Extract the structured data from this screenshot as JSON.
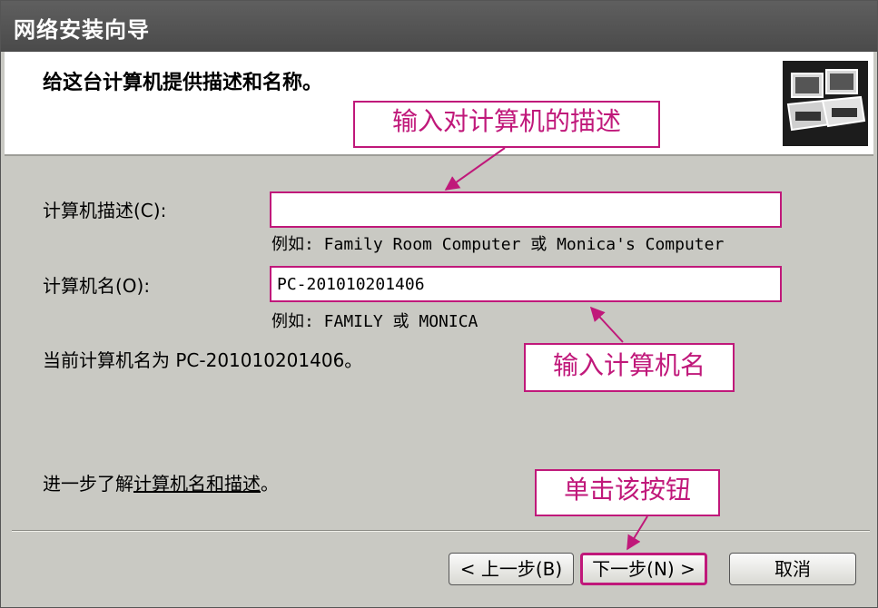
{
  "window": {
    "title": "网络安装向导"
  },
  "header": {
    "title": "给这台计算机提供描述和名称。",
    "icon": "computer-network-icon"
  },
  "form": {
    "description_label": "计算机描述(C):",
    "description_value": "",
    "description_hint": "例如: Family Room Computer 或 Monica's Computer",
    "name_label": "计算机名(O):",
    "name_value": "PC-201010201406",
    "name_hint": "例如: FAMILY 或 MONICA",
    "current_name": "当前计算机名为 PC-201010201406。"
  },
  "learn_more": {
    "prefix": "进一步了解",
    "link": "计算机名和描述",
    "suffix": "。"
  },
  "callouts": {
    "description": "输入对计算机的描述",
    "name": "输入计算机名",
    "next": "单击该按钮"
  },
  "buttons": {
    "back": "< 上一步(B)",
    "next": "下一步(N) >",
    "cancel": "取消"
  },
  "colors": {
    "annotation": "#c0187a",
    "titlebar": "#555555",
    "dialog_bg": "#c9c9c3"
  }
}
